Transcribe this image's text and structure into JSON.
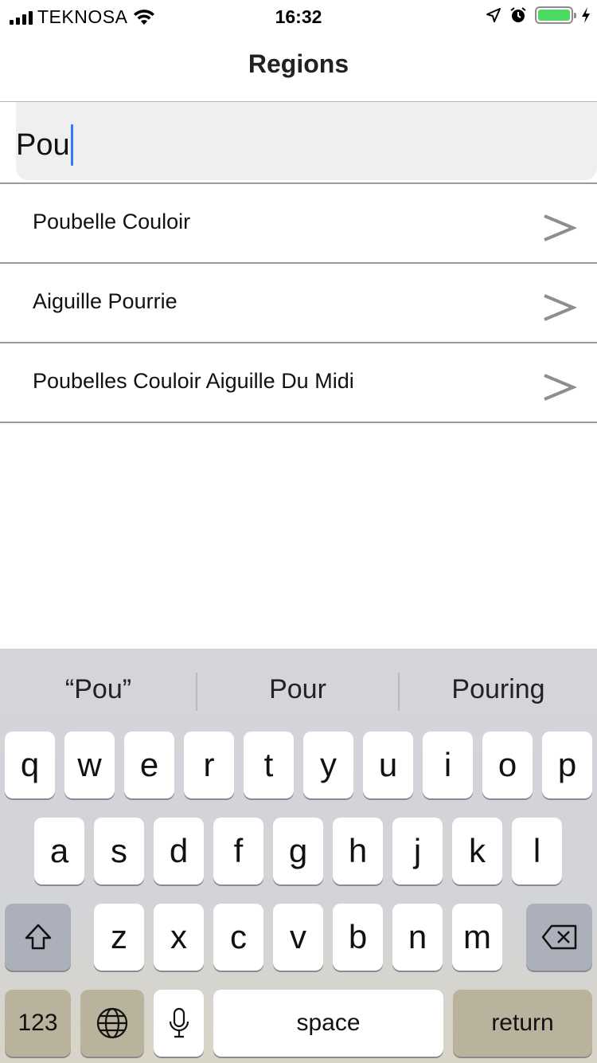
{
  "status_bar": {
    "carrier": "TEKNOSA",
    "time": "16:32"
  },
  "nav": {
    "title": "Regions"
  },
  "search": {
    "value": "Pou"
  },
  "results": [
    {
      "label": "Poubelle Couloir"
    },
    {
      "label": "Aiguille Pourrie"
    },
    {
      "label": "Poubelles Couloir Aiguille Du Midi"
    }
  ],
  "keyboard": {
    "suggestions": [
      "“Pou”",
      "Pour",
      "Pouring"
    ],
    "row1": [
      "q",
      "w",
      "e",
      "r",
      "t",
      "y",
      "u",
      "i",
      "o",
      "p"
    ],
    "row2": [
      "a",
      "s",
      "d",
      "f",
      "g",
      "h",
      "j",
      "k",
      "l"
    ],
    "row3": [
      "z",
      "x",
      "c",
      "v",
      "b",
      "n",
      "m"
    ],
    "numbers_label": "123",
    "space_label": "space",
    "return_label": "return"
  },
  "colors": {
    "accent": "#3478f6",
    "battery": "#4cd964"
  }
}
